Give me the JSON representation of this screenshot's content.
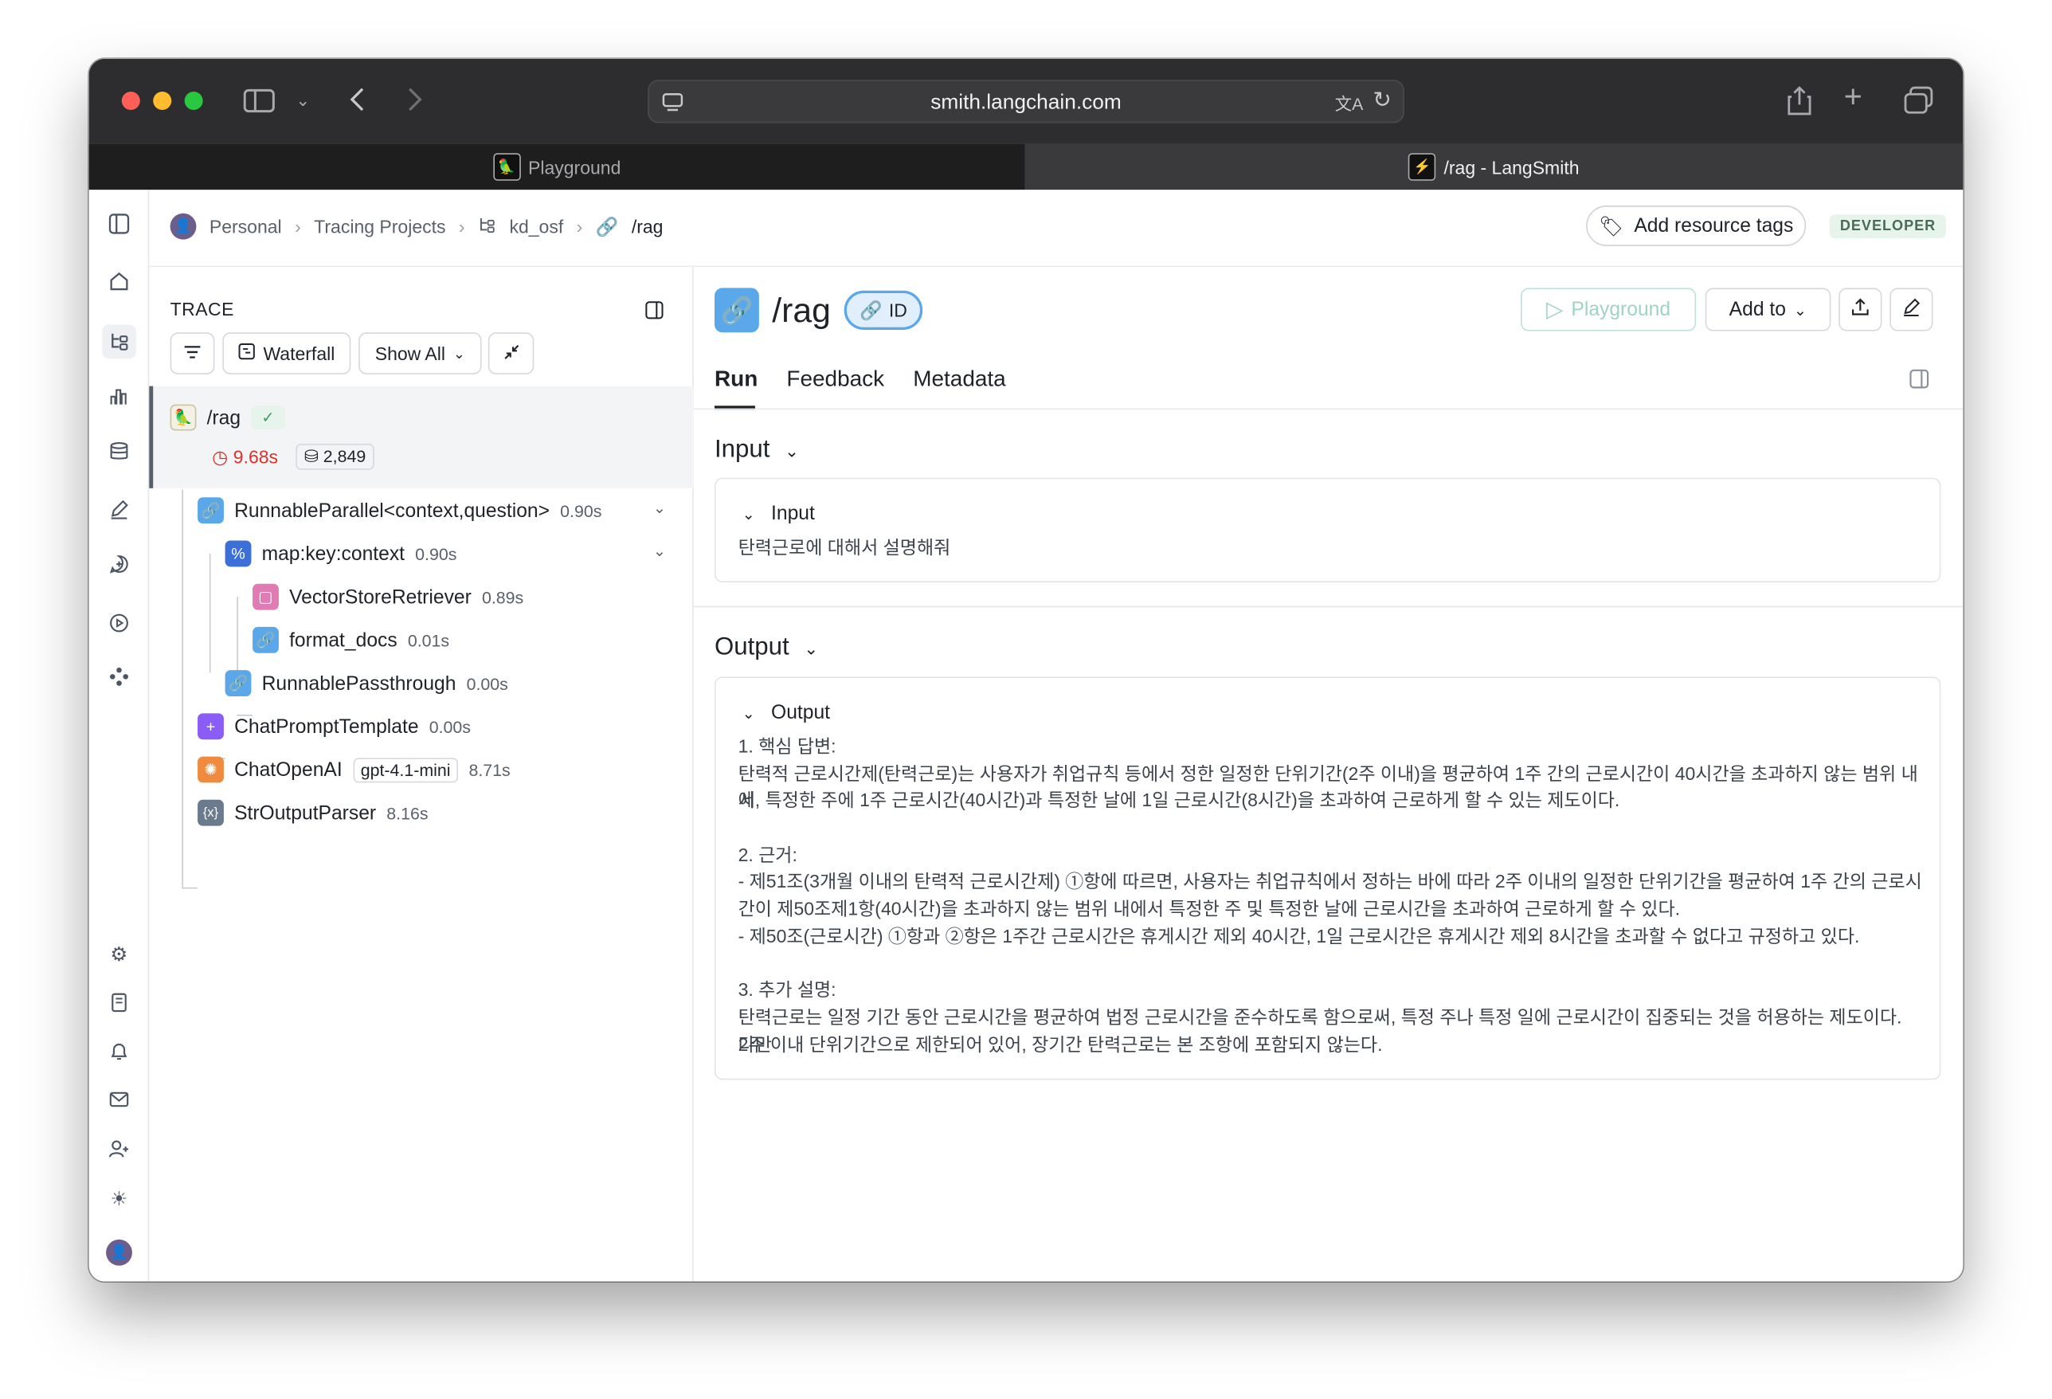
{
  "browser": {
    "url": "smith.langchain.com",
    "tabs": [
      {
        "label": "Playground",
        "active": false
      },
      {
        "label": "/rag - LangSmith",
        "active": true
      }
    ]
  },
  "breadcrumb": {
    "workspace": "Personal",
    "section": "Tracing Projects",
    "project": "kd_osf",
    "run": "/rag"
  },
  "header": {
    "tag_button": "Add resource tags",
    "badge": "DEVELOPER"
  },
  "trace": {
    "title": "TRACE",
    "toolbar": {
      "waterfall": "Waterfall",
      "show_all": "Show All"
    },
    "root": {
      "name": "/rag",
      "latency": "9.68s",
      "tokens": "2,849"
    },
    "nodes": [
      {
        "name": "RunnableParallel<context,question>",
        "duration": "0.90s"
      },
      {
        "name": "map:key:context",
        "duration": "0.90s"
      },
      {
        "name": "VectorStoreRetriever",
        "duration": "0.89s"
      },
      {
        "name": "format_docs",
        "duration": "0.01s"
      },
      {
        "name": "RunnablePassthrough",
        "duration": "0.00s"
      },
      {
        "name": "ChatPromptTemplate",
        "duration": "0.00s"
      },
      {
        "name": "ChatOpenAI",
        "duration": "8.71s",
        "model": "gpt-4.1-mini"
      },
      {
        "name": "StrOutputParser",
        "duration": "8.16s"
      }
    ]
  },
  "run": {
    "title": "/rag",
    "id_label": "ID",
    "playground_button": "Playground",
    "add_to_button": "Add to",
    "tabs": [
      "Run",
      "Feedback",
      "Metadata"
    ],
    "input_section": "Input",
    "input_card_title": "Input",
    "input_text": "탄력근로에 대해서 설명해줘",
    "output_section": "Output",
    "output_card_title": "Output",
    "output_lines": [
      "1. 핵심 답변:",
      "탄력적 근로시간제(탄력근로)는 사용자가 취업규칙 등에서 정한 일정한 단위기간(2주 이내)을 평균하여 1주 간의 근로시간이 40시간을 초과하지 않는 범위 내에",
      "서, 특정한 주에 1주 근로시간(40시간)과 특정한 날에 1일 근로시간(8시간)을 초과하여 근로하게 할 수 있는 제도이다.",
      "",
      "2. 근거:",
      "- 제51조(3개월 이내의 탄력적 근로시간제) ①항에 따르면, 사용자는 취업규칙에서 정하는 바에 따라 2주 이내의 일정한 단위기간을 평균하여 1주 간의 근로시",
      "간이 제50조제1항(40시간)을 초과하지 않는 범위 내에서 특정한 주 및 특정한 날에 근로시간을 초과하여 근로하게 할 수 있다.",
      "- 제50조(근로시간) ①항과 ②항은 1주간 근로시간은 휴게시간 제외 40시간, 1일 근로시간은 휴게시간 제외 8시간을 초과할 수 없다고 규정하고 있다.",
      "",
      "3. 추가 설명:",
      "탄력근로는 일정 기간 동안 근로시간을 평균하여 법정 근로시간을 준수하도록 함으로써, 특정 주나 특정 일에 근로시간이 집중되는 것을 허용하는 제도이다. 다만",
      "2주 이내 단위기간으로 제한되어 있어, 장기간 탄력근로는 본 조항에 포함되지 않는다."
    ]
  },
  "colors": {
    "accent_blue": "#5aa8ea",
    "error_red": "#d9342b",
    "success_green": "#3f9e63",
    "toolbar_dark": "#2d2d2f"
  }
}
